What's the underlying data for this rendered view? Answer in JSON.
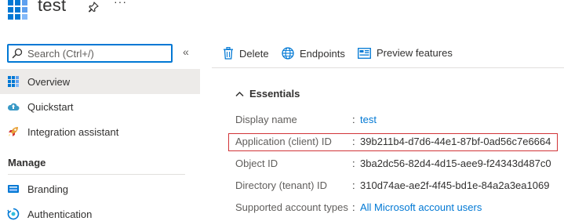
{
  "header": {
    "title": "test",
    "more_label": "···",
    "app_icon": "app-registration-grid-icon",
    "pin_icon": "pin-icon"
  },
  "sidebar": {
    "search_placeholder": "Search (Ctrl+/)",
    "collapse_label": "«",
    "items": [
      {
        "label": "Overview",
        "icon": "overview-grid-icon",
        "active": true
      },
      {
        "label": "Quickstart",
        "icon": "cloud-quickstart-icon",
        "active": false
      },
      {
        "label": "Integration assistant",
        "icon": "rocket-icon",
        "active": false
      }
    ],
    "section": "Manage",
    "manage_items": [
      {
        "label": "Branding",
        "icon": "branding-icon"
      },
      {
        "label": "Authentication",
        "icon": "authentication-icon"
      }
    ]
  },
  "toolbar": {
    "delete_label": "Delete",
    "endpoints_label": "Endpoints",
    "preview_label": "Preview features"
  },
  "essentials": {
    "title": "Essentials",
    "properties": [
      {
        "label": "Display name",
        "value": "test",
        "link": true
      },
      {
        "label": "Application (client) ID",
        "value": "39b211b4-d7d6-44e1-87bf-0ad56c7e6664",
        "link": false,
        "highlighted": true
      },
      {
        "label": "Object ID",
        "value": "3ba2dc56-82d4-4d15-aee9-f24343d487c0",
        "link": false
      },
      {
        "label": "Directory (tenant) ID",
        "value": "310d74ae-ae2f-4f45-bd1e-84a2a3ea1069",
        "link": false
      },
      {
        "label": "Supported account types",
        "value": "All Microsoft account users",
        "link": true
      }
    ],
    "colon": ":"
  },
  "colors": {
    "accent": "#0078d4",
    "highlight_border": "#d13438",
    "active_nav_bg": "#edebe9"
  }
}
